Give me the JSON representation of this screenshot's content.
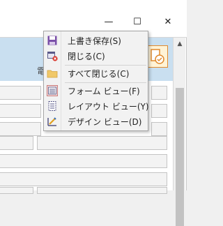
{
  "window": {
    "minimize_symbol": "—",
    "maximize_symbol": "☐",
    "close_symbol": "✕"
  },
  "header": {
    "partial_text": "電"
  },
  "context_menu": {
    "items": [
      {
        "label": "上書き保存(S)",
        "icon": "save-icon"
      },
      {
        "label": "閉じる(C)",
        "icon": "close-form-icon"
      },
      {
        "label": "すべて閉じる(C)",
        "icon": "folder-icon"
      },
      {
        "label": "フォーム ビュー(F)",
        "icon": "form-view-icon"
      },
      {
        "label": "レイアウト ビュー(Y)",
        "icon": "layout-view-icon"
      },
      {
        "label": "デザイン ビュー(D)",
        "icon": "design-view-icon"
      }
    ]
  },
  "colors": {
    "header": "#c9dff0",
    "menu_bg": "#f2f2f2",
    "accent_icon": "#7a4fa8"
  }
}
